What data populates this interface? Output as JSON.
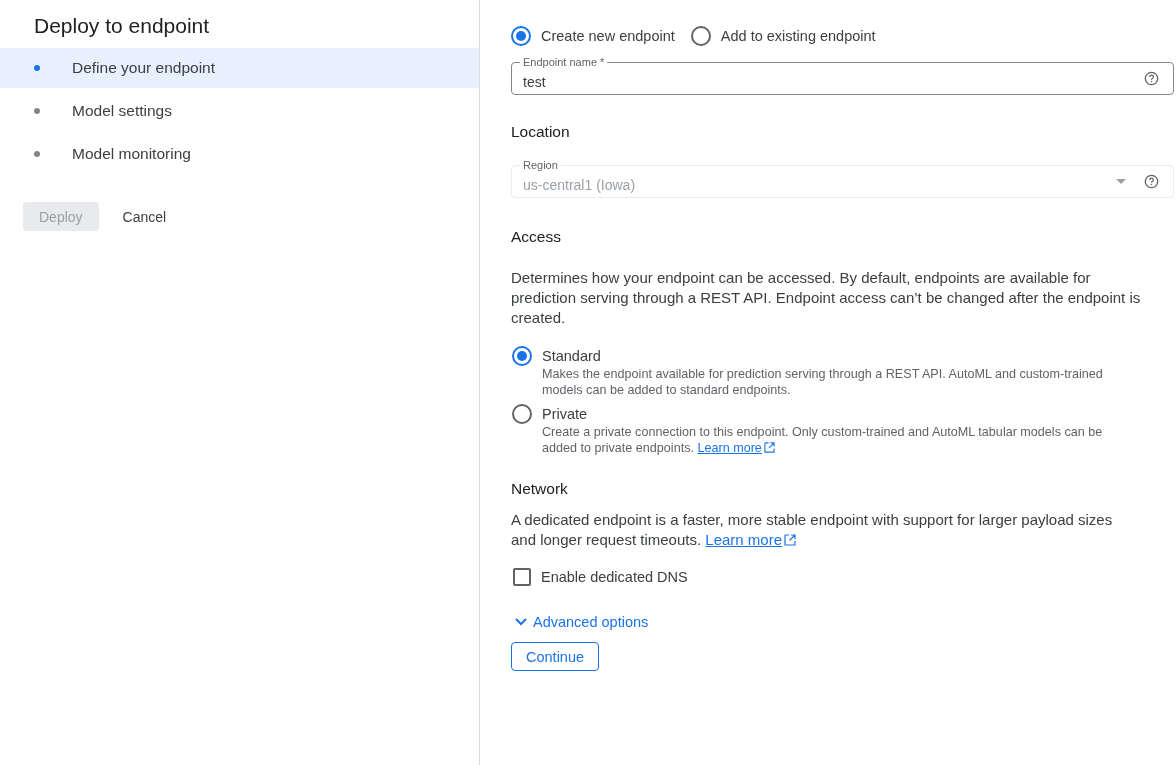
{
  "title": "Deploy to endpoint",
  "steps": [
    {
      "label": "Define your endpoint",
      "selected": true
    },
    {
      "label": "Model settings",
      "selected": false
    },
    {
      "label": "Model monitoring",
      "selected": false
    }
  ],
  "actions": [
    {
      "label": "Deploy",
      "disabled": true
    },
    {
      "label": "Cancel",
      "disabled": false
    }
  ],
  "endpoint_mode": [
    {
      "label": "Create new endpoint",
      "selected": true
    },
    {
      "label": "Add to existing endpoint",
      "selected": false
    }
  ],
  "endpoint_name": {
    "label": "Endpoint name *",
    "value": "test"
  },
  "location": {
    "heading": "Location",
    "region": {
      "label": "Region",
      "value": "us-central1 (Iowa)",
      "disabled": true
    }
  },
  "access": {
    "heading": "Access",
    "description": "Determines how your endpoint can be accessed. By default, endpoints are available for prediction serving through a REST API. Endpoint access can’t be changed after the endpoint is created.",
    "options": [
      {
        "label": "Standard",
        "description": "Makes the endpoint available for prediction serving through a REST API. AutoML and custom-trained models can be added to standard endpoints.",
        "selected": true
      },
      {
        "label": "Private",
        "description": "Create a private connection to this endpoint. Only custom-trained and AutoML tabular models can be added to private endpoints.",
        "link": "Learn more",
        "selected": false
      }
    ]
  },
  "network": {
    "heading": "Network",
    "description": "A dedicated endpoint is a faster, more stable endpoint with support for larger payload sizes and longer request timeouts.",
    "link": "Learn more",
    "dns": {
      "label": "Enable dedicated DNS",
      "checked": false
    }
  },
  "advanced": {
    "label": "Advanced options",
    "expanded": false
  },
  "continue": "Continue"
}
